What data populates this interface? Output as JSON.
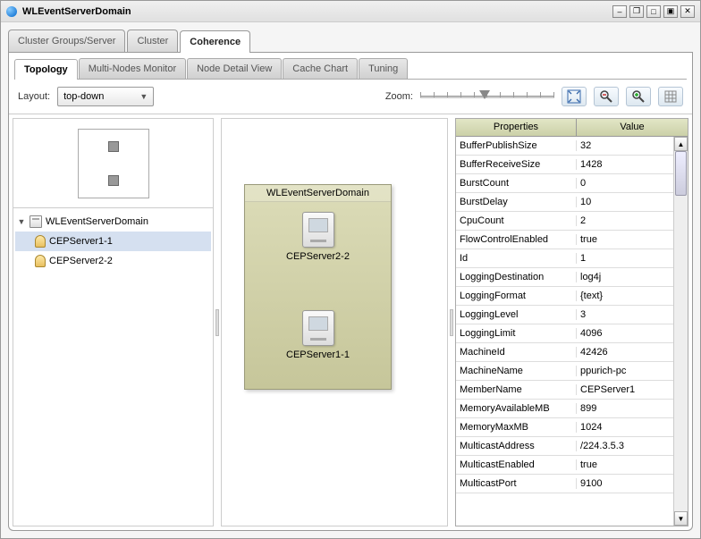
{
  "window": {
    "title": "WLEventServerDomain"
  },
  "outerTabs": [
    "Cluster Groups/Server",
    "Cluster",
    "Coherence"
  ],
  "outerTabActive": 2,
  "innerTabs": [
    "Topology",
    "Multi-Nodes Monitor",
    "Node Detail View",
    "Cache Chart",
    "Tuning"
  ],
  "innerTabActive": 0,
  "toolbar": {
    "layoutLabel": "Layout:",
    "layoutValue": "top-down",
    "zoomLabel": "Zoom:"
  },
  "tree": {
    "root": "WLEventServerDomain",
    "children": [
      "CEPServer1-1",
      "CEPServer2-2"
    ],
    "selectedIndex": 0
  },
  "canvas": {
    "domainTitle": "WLEventServerDomain",
    "nodes": [
      "CEPServer2-2",
      "CEPServer1-1"
    ]
  },
  "properties": {
    "headerKey": "Properties",
    "headerVal": "Value",
    "rows": [
      {
        "k": "BufferPublishSize",
        "v": "32"
      },
      {
        "k": "BufferReceiveSize",
        "v": "1428"
      },
      {
        "k": "BurstCount",
        "v": "0"
      },
      {
        "k": "BurstDelay",
        "v": "10"
      },
      {
        "k": "CpuCount",
        "v": "2"
      },
      {
        "k": "FlowControlEnabled",
        "v": "true"
      },
      {
        "k": "Id",
        "v": "1"
      },
      {
        "k": "LoggingDestination",
        "v": "log4j"
      },
      {
        "k": "LoggingFormat",
        "v": "{text}"
      },
      {
        "k": "LoggingLevel",
        "v": "3"
      },
      {
        "k": "LoggingLimit",
        "v": "4096"
      },
      {
        "k": "MachineId",
        "v": "42426"
      },
      {
        "k": "MachineName",
        "v": "ppurich-pc"
      },
      {
        "k": "MemberName",
        "v": "CEPServer1"
      },
      {
        "k": "MemoryAvailableMB",
        "v": "899"
      },
      {
        "k": "MemoryMaxMB",
        "v": "1024"
      },
      {
        "k": "MulticastAddress",
        "v": "/224.3.5.3"
      },
      {
        "k": "MulticastEnabled",
        "v": "true"
      },
      {
        "k": "MulticastPort",
        "v": "9100"
      }
    ]
  }
}
